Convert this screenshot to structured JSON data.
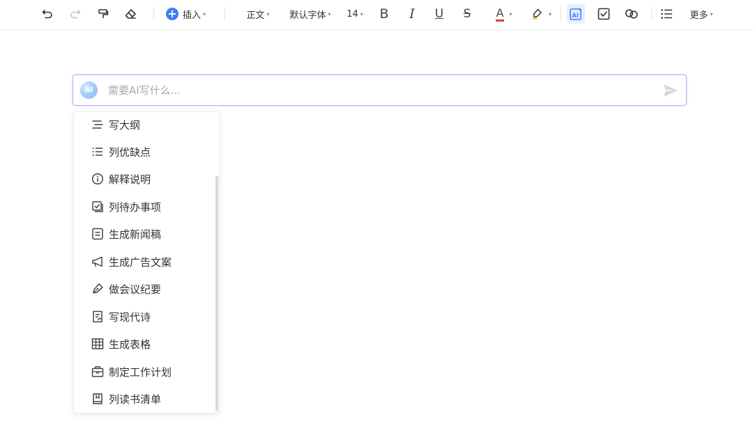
{
  "toolbar": {
    "undo_icon": "undo-icon",
    "redo_icon": "redo-icon",
    "format_painter_icon": "format-painter-icon",
    "clear_format_icon": "eraser-icon",
    "insert_label": "插入",
    "insert_icon_glyph": "+",
    "style_label": "正文",
    "font_family_label": "默认字体",
    "font_size_label": "14",
    "bold_label": "B",
    "italic_label": "I",
    "underline_label": "U",
    "strike_label": "S",
    "font_color_label": "A",
    "font_color": "#e23b3b",
    "highlight_icon": "highlighter-icon",
    "ai_icon": "ai-icon",
    "checkbox_icon": "task-checkbox-icon",
    "link_icon": "link-icon",
    "list_icon": "bulleted-list-icon",
    "more_label": "更多",
    "caret_glyph": "▾"
  },
  "ai_prompt": {
    "badge_text": "AI",
    "placeholder": "需要AI写什么...",
    "value": "",
    "send_icon": "send-icon",
    "border_color": "#b7a8f6"
  },
  "menu": {
    "items": [
      {
        "label": "写大纲",
        "icon": "outline-icon"
      },
      {
        "label": "列优缺点",
        "icon": "list-icon"
      },
      {
        "label": "解释说明",
        "icon": "info-icon"
      },
      {
        "label": "列待办事项",
        "icon": "todo-icon"
      },
      {
        "label": "生成新闻稿",
        "icon": "document-icon"
      },
      {
        "label": "生成广告文案",
        "icon": "megaphone-icon"
      },
      {
        "label": "做会议纪要",
        "icon": "pen-icon"
      },
      {
        "label": "写现代诗",
        "icon": "poem-icon"
      },
      {
        "label": "生成表格",
        "icon": "table-icon"
      },
      {
        "label": "制定工作计划",
        "icon": "briefcase-icon"
      },
      {
        "label": "列读书清单",
        "icon": "book-icon"
      }
    ]
  }
}
